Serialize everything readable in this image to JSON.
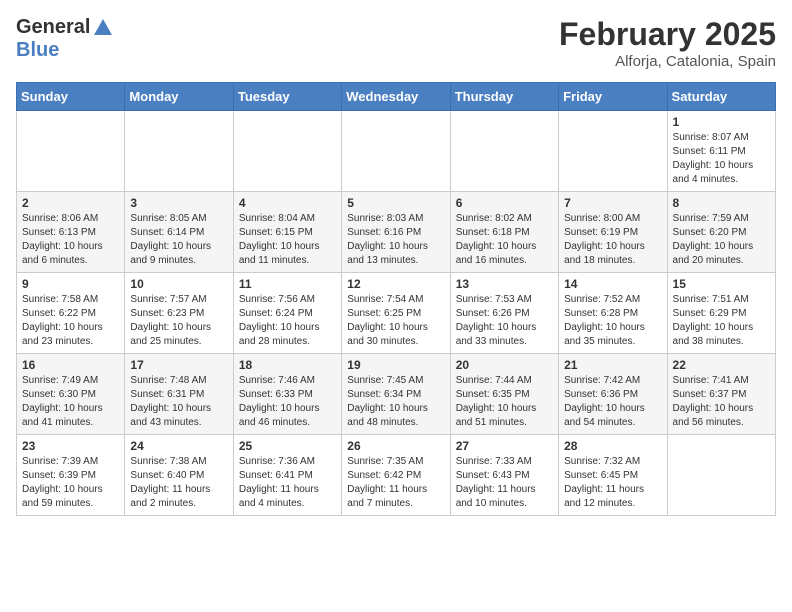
{
  "header": {
    "logo_line1": "General",
    "logo_line2": "Blue",
    "month_title": "February 2025",
    "location": "Alforja, Catalonia, Spain"
  },
  "calendar": {
    "days_of_week": [
      "Sunday",
      "Monday",
      "Tuesday",
      "Wednesday",
      "Thursday",
      "Friday",
      "Saturday"
    ],
    "weeks": [
      [
        {
          "num": "",
          "info": ""
        },
        {
          "num": "",
          "info": ""
        },
        {
          "num": "",
          "info": ""
        },
        {
          "num": "",
          "info": ""
        },
        {
          "num": "",
          "info": ""
        },
        {
          "num": "",
          "info": ""
        },
        {
          "num": "1",
          "info": "Sunrise: 8:07 AM\nSunset: 6:11 PM\nDaylight: 10 hours and 4 minutes."
        }
      ],
      [
        {
          "num": "2",
          "info": "Sunrise: 8:06 AM\nSunset: 6:13 PM\nDaylight: 10 hours and 6 minutes."
        },
        {
          "num": "3",
          "info": "Sunrise: 8:05 AM\nSunset: 6:14 PM\nDaylight: 10 hours and 9 minutes."
        },
        {
          "num": "4",
          "info": "Sunrise: 8:04 AM\nSunset: 6:15 PM\nDaylight: 10 hours and 11 minutes."
        },
        {
          "num": "5",
          "info": "Sunrise: 8:03 AM\nSunset: 6:16 PM\nDaylight: 10 hours and 13 minutes."
        },
        {
          "num": "6",
          "info": "Sunrise: 8:02 AM\nSunset: 6:18 PM\nDaylight: 10 hours and 16 minutes."
        },
        {
          "num": "7",
          "info": "Sunrise: 8:00 AM\nSunset: 6:19 PM\nDaylight: 10 hours and 18 minutes."
        },
        {
          "num": "8",
          "info": "Sunrise: 7:59 AM\nSunset: 6:20 PM\nDaylight: 10 hours and 20 minutes."
        }
      ],
      [
        {
          "num": "9",
          "info": "Sunrise: 7:58 AM\nSunset: 6:22 PM\nDaylight: 10 hours and 23 minutes."
        },
        {
          "num": "10",
          "info": "Sunrise: 7:57 AM\nSunset: 6:23 PM\nDaylight: 10 hours and 25 minutes."
        },
        {
          "num": "11",
          "info": "Sunrise: 7:56 AM\nSunset: 6:24 PM\nDaylight: 10 hours and 28 minutes."
        },
        {
          "num": "12",
          "info": "Sunrise: 7:54 AM\nSunset: 6:25 PM\nDaylight: 10 hours and 30 minutes."
        },
        {
          "num": "13",
          "info": "Sunrise: 7:53 AM\nSunset: 6:26 PM\nDaylight: 10 hours and 33 minutes."
        },
        {
          "num": "14",
          "info": "Sunrise: 7:52 AM\nSunset: 6:28 PM\nDaylight: 10 hours and 35 minutes."
        },
        {
          "num": "15",
          "info": "Sunrise: 7:51 AM\nSunset: 6:29 PM\nDaylight: 10 hours and 38 minutes."
        }
      ],
      [
        {
          "num": "16",
          "info": "Sunrise: 7:49 AM\nSunset: 6:30 PM\nDaylight: 10 hours and 41 minutes."
        },
        {
          "num": "17",
          "info": "Sunrise: 7:48 AM\nSunset: 6:31 PM\nDaylight: 10 hours and 43 minutes."
        },
        {
          "num": "18",
          "info": "Sunrise: 7:46 AM\nSunset: 6:33 PM\nDaylight: 10 hours and 46 minutes."
        },
        {
          "num": "19",
          "info": "Sunrise: 7:45 AM\nSunset: 6:34 PM\nDaylight: 10 hours and 48 minutes."
        },
        {
          "num": "20",
          "info": "Sunrise: 7:44 AM\nSunset: 6:35 PM\nDaylight: 10 hours and 51 minutes."
        },
        {
          "num": "21",
          "info": "Sunrise: 7:42 AM\nSunset: 6:36 PM\nDaylight: 10 hours and 54 minutes."
        },
        {
          "num": "22",
          "info": "Sunrise: 7:41 AM\nSunset: 6:37 PM\nDaylight: 10 hours and 56 minutes."
        }
      ],
      [
        {
          "num": "23",
          "info": "Sunrise: 7:39 AM\nSunset: 6:39 PM\nDaylight: 10 hours and 59 minutes."
        },
        {
          "num": "24",
          "info": "Sunrise: 7:38 AM\nSunset: 6:40 PM\nDaylight: 11 hours and 2 minutes."
        },
        {
          "num": "25",
          "info": "Sunrise: 7:36 AM\nSunset: 6:41 PM\nDaylight: 11 hours and 4 minutes."
        },
        {
          "num": "26",
          "info": "Sunrise: 7:35 AM\nSunset: 6:42 PM\nDaylight: 11 hours and 7 minutes."
        },
        {
          "num": "27",
          "info": "Sunrise: 7:33 AM\nSunset: 6:43 PM\nDaylight: 11 hours and 10 minutes."
        },
        {
          "num": "28",
          "info": "Sunrise: 7:32 AM\nSunset: 6:45 PM\nDaylight: 11 hours and 12 minutes."
        },
        {
          "num": "",
          "info": ""
        }
      ]
    ]
  }
}
